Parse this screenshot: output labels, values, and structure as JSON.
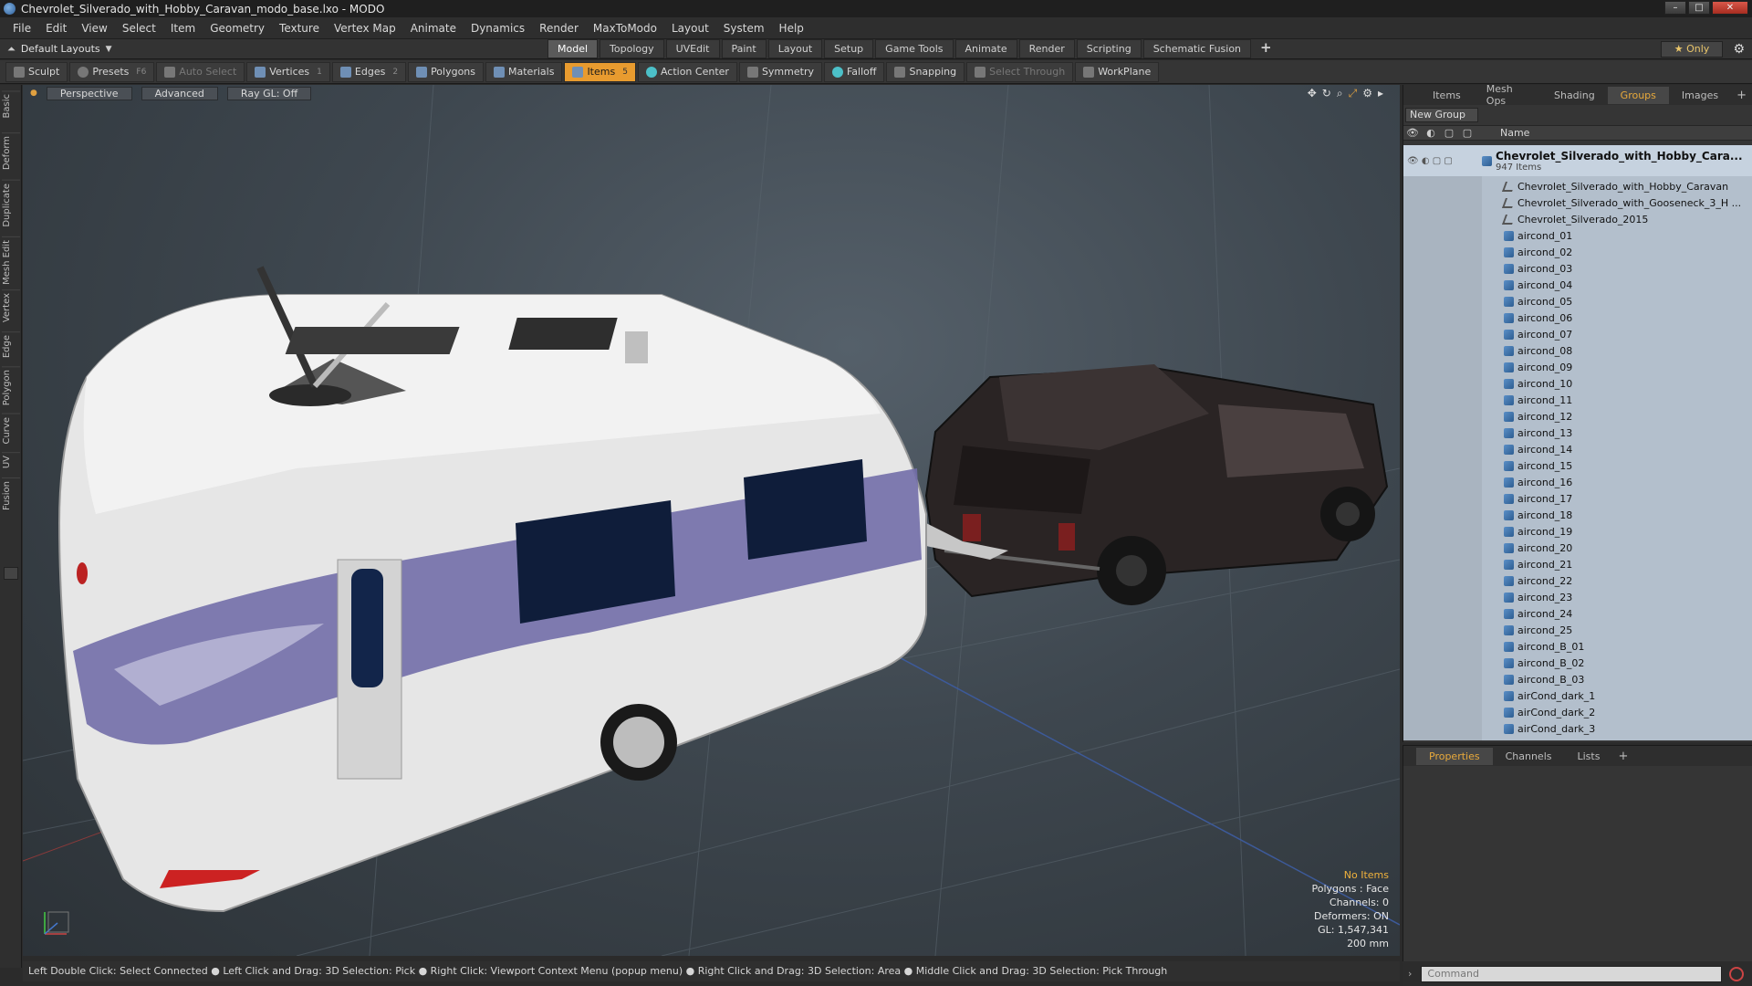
{
  "window": {
    "title": "Chevrolet_Silverado_with_Hobby_Caravan_modo_base.lxo - MODO",
    "controls": [
      "–",
      "□",
      "✕"
    ]
  },
  "menu": [
    "File",
    "Edit",
    "View",
    "Select",
    "Item",
    "Geometry",
    "Texture",
    "Vertex Map",
    "Animate",
    "Dynamics",
    "Render",
    "MaxToModo",
    "Layout",
    "System",
    "Help"
  ],
  "layout_bar": {
    "layout_name": "Default Layouts",
    "tabs": [
      "Model",
      "Topology",
      "UVEdit",
      "Paint",
      "Layout",
      "Setup",
      "Game Tools",
      "Animate",
      "Render",
      "Scripting",
      "Schematic Fusion"
    ],
    "active_tab": "Model",
    "only_label": "Only"
  },
  "toolbar": {
    "sculpt": "Sculpt",
    "presets": "Presets",
    "presets_key": "F6",
    "auto_select": "Auto Select",
    "vertices": "Vertices",
    "vertices_key": "1",
    "edges": "Edges",
    "edges_key": "2",
    "polygons": "Polygons",
    "materials": "Materials",
    "items": "Items",
    "items_key": "5",
    "action_center": "Action Center",
    "symmetry": "Symmetry",
    "falloff": "Falloff",
    "snapping": "Snapping",
    "select_through": "Select Through",
    "workplane": "WorkPlane"
  },
  "left_tabs": [
    "Basic",
    "Deform",
    "Duplicate",
    "Mesh Edit",
    "Vertex",
    "Edge",
    "Polygon",
    "Curve",
    "UV",
    "Fusion"
  ],
  "viewport": {
    "view_mode": "Perspective",
    "advanced": "Advanced",
    "raygl": "Ray GL: Off",
    "info": {
      "selection": "No Items",
      "polygons": "Polygons : Face",
      "channels": "Channels: 0",
      "deformers": "Deformers: ON",
      "gl": "GL: 1,547,341",
      "scale": "200 mm"
    }
  },
  "statusbar": {
    "text": "Left Double Click: Select Connected ● Left Click and Drag: 3D Selection: Pick ● Right Click: Viewport Context Menu (popup menu) ● Right Click and Drag: 3D Selection: Area ● Middle Click and Drag: 3D Selection: Pick Through"
  },
  "right_panel": {
    "tabs": [
      "Items",
      "Mesh Ops",
      "Shading",
      "Groups",
      "Images"
    ],
    "active_tab": "Groups",
    "new_group": "New Group",
    "name_header": "Name",
    "root": {
      "name": "Chevrolet_Silverado_with_Hobby_Cara...",
      "count": "947 Items"
    },
    "items": [
      "Chevrolet_Silverado_with_Hobby_Caravan",
      "Chevrolet_Silverado_with_Gooseneck_3_H ...",
      "Chevrolet_Silverado_2015",
      "aircond_01",
      "aircond_02",
      "aircond_03",
      "aircond_04",
      "aircond_05",
      "aircond_06",
      "aircond_07",
      "aircond_08",
      "aircond_09",
      "aircond_10",
      "aircond_11",
      "aircond_12",
      "aircond_13",
      "aircond_14",
      "aircond_15",
      "aircond_16",
      "aircond_17",
      "aircond_18",
      "aircond_19",
      "aircond_20",
      "aircond_21",
      "aircond_22",
      "aircond_23",
      "aircond_24",
      "aircond_25",
      "aircond_B_01",
      "aircond_B_02",
      "aircond_B_03",
      "airCond_dark_1",
      "airCond_dark_2",
      "airCond_dark_3"
    ]
  },
  "properties_panel": {
    "tabs": [
      "Properties",
      "Channels",
      "Lists"
    ],
    "active_tab": "Properties"
  },
  "command": {
    "placeholder": "Command"
  },
  "colors": {
    "accent": "#e89b2f",
    "tree_bg": "#b3bfcc"
  }
}
